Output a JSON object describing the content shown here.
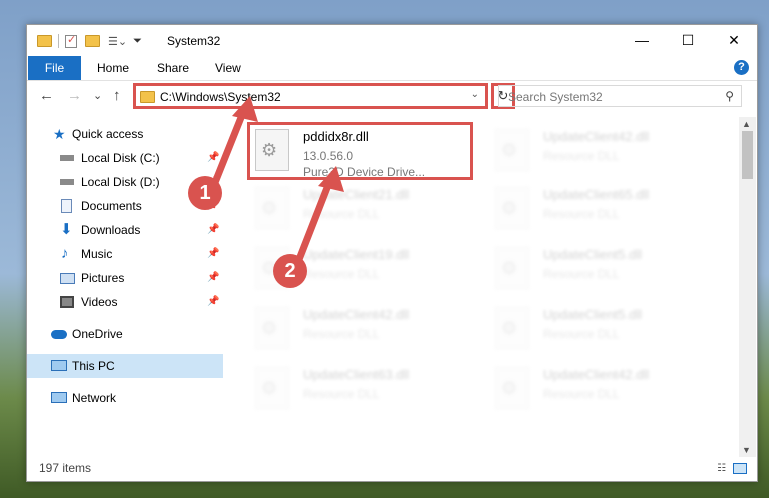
{
  "window": {
    "title": "System32",
    "minimize_glyph": "—",
    "maximize_glyph": "☐",
    "close_glyph": "✕"
  },
  "ribbon": {
    "file": "File",
    "home": "Home",
    "share": "Share",
    "view": "View",
    "help_glyph": "?"
  },
  "address": {
    "path": "C:\\Windows\\System32",
    "dropdown_glyph": "⌄",
    "refresh_glyph": "↻"
  },
  "search": {
    "placeholder": "Search System32",
    "icon": "⚲"
  },
  "nav_buttons": {
    "back": "←",
    "forward": "→",
    "recent": "⌄",
    "up": "↑"
  },
  "sidebar": {
    "items": [
      {
        "label": "Quick access",
        "icon": "star-icon",
        "pinned": false
      },
      {
        "label": "Local Disk (C:)",
        "icon": "drive-icon",
        "pinned": true
      },
      {
        "label": "Local Disk (D:)",
        "icon": "drive-icon",
        "pinned": true
      },
      {
        "label": "Documents",
        "icon": "documents-icon",
        "pinned": true
      },
      {
        "label": "Downloads",
        "icon": "download-icon",
        "pinned": true
      },
      {
        "label": "Music",
        "icon": "music-icon",
        "pinned": true
      },
      {
        "label": "Pictures",
        "icon": "pictures-icon",
        "pinned": true
      },
      {
        "label": "Videos",
        "icon": "videos-icon",
        "pinned": true
      },
      {
        "label": "OneDrive",
        "icon": "cloud-icon",
        "pinned": false
      },
      {
        "label": "This PC",
        "icon": "computer-icon",
        "pinned": false,
        "selected": true
      },
      {
        "label": "Network",
        "icon": "network-icon",
        "pinned": false
      }
    ],
    "pin_glyph": "📌"
  },
  "files": [
    {
      "name": "pddidx8r.dll",
      "version": "13.0.56.0",
      "type": "Pure3D Device Drive...",
      "highlighted": true
    },
    {
      "name": "UpdateClient42.dll",
      "type": "Resource DLL"
    },
    {
      "name": "UpdateClient21.dll",
      "type": "Resource DLL"
    },
    {
      "name": "UpdateClient65.dll",
      "type": "Resource DLL"
    },
    {
      "name": "UpdateClient19.dll",
      "type": "Resource DLL"
    },
    {
      "name": "UpdateClient5.dll",
      "type": "Resource DLL"
    },
    {
      "name": "UpdateClient42.dll",
      "type": "Resource DLL"
    },
    {
      "name": "UpdateClient5.dll",
      "type": "Resource DLL"
    },
    {
      "name": "UpdateClient63.dll",
      "type": "Resource DLL"
    },
    {
      "name": "UpdateClient42.dll",
      "type": "Resource DLL"
    }
  ],
  "status": {
    "count": "197 items"
  },
  "annotations": {
    "badge1": "1",
    "badge2": "2"
  },
  "colors": {
    "accent": "#1a6fc4",
    "highlight": "#d9534f",
    "selected_bg": "#cce4f7"
  }
}
